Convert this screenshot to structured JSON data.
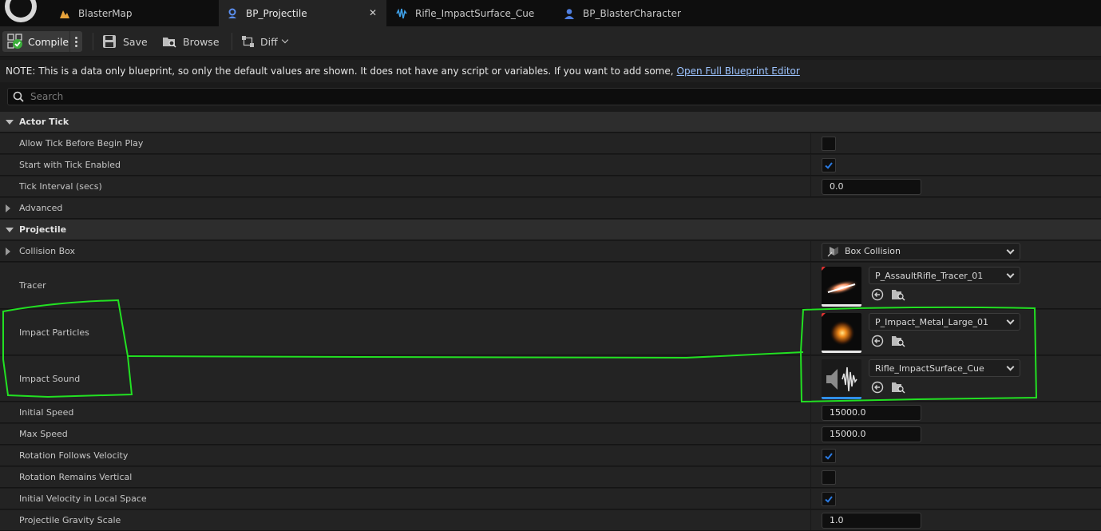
{
  "tabs": [
    {
      "label": "BlasterMap",
      "icon": "level-icon"
    },
    {
      "label": "BP_Projectile",
      "icon": "blueprint-icon",
      "active": true,
      "close": "✕"
    },
    {
      "label": "Rifle_ImpactSurface_Cue",
      "icon": "sound-cue-icon"
    },
    {
      "label": "BP_BlasterCharacter",
      "icon": "character-icon"
    }
  ],
  "toolbar": {
    "compile": "Compile",
    "save": "Save",
    "browse": "Browse",
    "diff": "Diff"
  },
  "note": {
    "text": "NOTE: This is a data only blueprint, so only the default values are shown.  It does not have any script or variables.  If you want to add some,",
    "link": "Open Full Blueprint Editor"
  },
  "search": {
    "placeholder": "Search"
  },
  "actor_tick": {
    "category": "Actor Tick",
    "allow_tick_label": "Allow Tick Before Begin Play",
    "allow_tick_checked": false,
    "start_tick_label": "Start with Tick Enabled",
    "start_tick_checked": true,
    "tick_interval_label": "Tick Interval (secs)",
    "tick_interval_value": "0.0",
    "advanced_label": "Advanced"
  },
  "projectile": {
    "category": "Projectile",
    "collision_box_label": "Collision Box",
    "collision_box_value": "Box Collision",
    "tracer_label": "Tracer",
    "tracer_value": "P_AssaultRifle_Tracer_01",
    "impact_particles_label": "Impact Particles",
    "impact_particles_value": "P_Impact_Metal_Large_01",
    "impact_sound_label": "Impact Sound",
    "impact_sound_value": "Rifle_ImpactSurface_Cue",
    "initial_speed_label": "Initial Speed",
    "initial_speed_value": "15000.0",
    "max_speed_label": "Max Speed",
    "max_speed_value": "15000.0",
    "rotation_follows_label": "Rotation Follows Velocity",
    "rotation_follows_checked": true,
    "rotation_vertical_label": "Rotation Remains Vertical",
    "rotation_vertical_checked": false,
    "initial_velocity_local_label": "Initial Velocity in Local Space",
    "initial_velocity_local_checked": true,
    "gravity_scale_label": "Projectile Gravity Scale",
    "gravity_scale_value": "1.0"
  },
  "colors": {
    "accent_check": "#2a7be4",
    "annotation": "#22e022",
    "link": "#9cc3ff"
  }
}
